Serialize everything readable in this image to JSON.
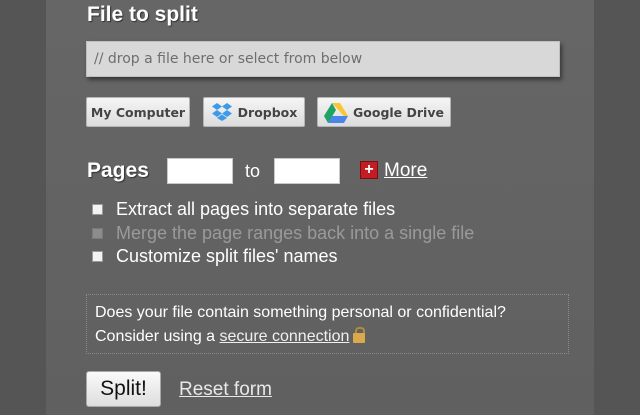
{
  "form": {
    "title": "File to split",
    "drop_placeholder": "// drop a file here or select from below"
  },
  "sources": [
    {
      "label": "My Computer",
      "icon": "none"
    },
    {
      "label": "Dropbox",
      "icon": "dropbox-icon"
    },
    {
      "label": "Google Drive",
      "icon": "google-drive-icon"
    }
  ],
  "pages": {
    "label": "Pages",
    "from_value": "",
    "to_label": "to",
    "to_value": "",
    "more_label": "More"
  },
  "options": [
    {
      "label": "Extract all pages into separate files",
      "checked": false,
      "enabled": true
    },
    {
      "label": "Merge the page ranges back into a single file",
      "checked": false,
      "enabled": false
    },
    {
      "label": "Customize split files' names",
      "checked": false,
      "enabled": true
    }
  ],
  "notice": {
    "line1": "Does your file contain something personal or confidential?",
    "line2_prefix": "Consider using a",
    "link": "secure connection"
  },
  "actions": {
    "split_label": "Split!",
    "reset_label": "Reset form"
  },
  "colors": {
    "background": "#5e5e5e",
    "panel": "#666666",
    "more_icon": "#c21d24",
    "lock_icon": "#d9a94a"
  }
}
